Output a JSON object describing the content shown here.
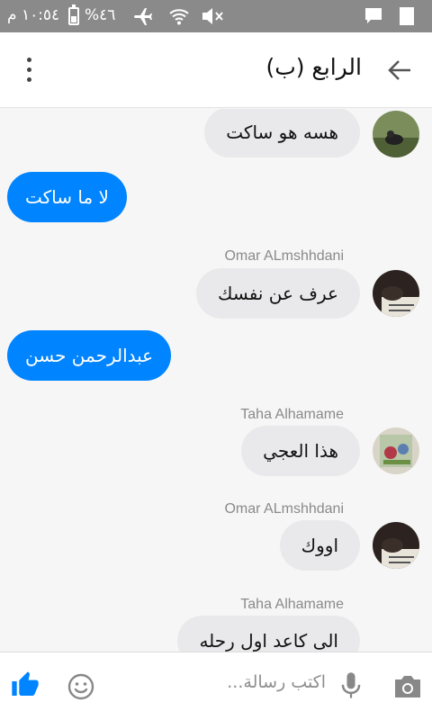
{
  "status_bar": {
    "time": "١٠:٥٤ م",
    "battery_percent": "%٤٦",
    "battery_level": 0.46
  },
  "header": {
    "title": "الرابع (ب)"
  },
  "messages": [
    {
      "direction": "incoming",
      "sender": "",
      "text": "هسه هو ساكت"
    },
    {
      "direction": "outgoing",
      "text": "لا ما ساكت"
    },
    {
      "direction": "incoming",
      "sender": "Omar ALmshhdani",
      "text": "عرف عن نفسك"
    },
    {
      "direction": "outgoing",
      "text": "عبدالرحمن حسن"
    },
    {
      "direction": "incoming",
      "sender": "Taha Alhamame",
      "text": "هذا العجي"
    },
    {
      "direction": "incoming",
      "sender": "Omar ALmshhdani",
      "text": "اووك"
    },
    {
      "direction": "incoming",
      "sender": "Taha Alhamame",
      "text": "الى كاعد اول رحله"
    }
  ],
  "composer": {
    "placeholder": "اكتب رسالة..."
  },
  "colors": {
    "accent": "#0084ff",
    "incoming_bubble": "#e9e9eb",
    "status_bar": "#8a8a8a"
  },
  "icons": [
    "airplane-mode-icon",
    "wifi-icon",
    "mute-icon",
    "chat-notification-icon",
    "signal-icon",
    "more-options-icon",
    "back-arrow-icon",
    "like-icon",
    "emoji-icon",
    "microphone-icon",
    "camera-icon"
  ]
}
